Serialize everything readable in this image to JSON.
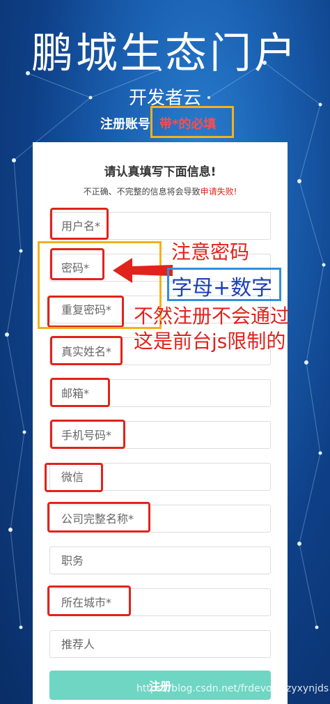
{
  "header": {
    "title": "鹏城生态门户",
    "subtitle": "开发者云",
    "register_label": "注册账号",
    "register_note": "带*的必填"
  },
  "card": {
    "heading": "请认真填写下面信息!",
    "sub_prefix": "不正确、不完整的信息将会导致",
    "sub_error": "申请失败!"
  },
  "fields": {
    "username": "用户名*",
    "password": "密码*",
    "password_repeat": "重复密码*",
    "real_name": "真实姓名*",
    "email": "邮箱*",
    "phone": "手机号码*",
    "wechat": "微信",
    "company": "公司完整名称*",
    "position": "职务",
    "city": "所在城市*",
    "referrer": "推荐人"
  },
  "submit_label": "注册",
  "annotations": {
    "note_password": "注意密码",
    "letters_digits": "字母+数字",
    "line_1": "不然注册不会通过",
    "line_2": "这是前台js限制的"
  },
  "watermark": "https://blog.csdn.net/frdevolcqzyxynjds",
  "colors": {
    "annotation_red": "#e0231b",
    "annotation_yellow": "#f2b21b",
    "annotation_blue": "#2f8fe0",
    "submit_button": "#6fd6c3"
  }
}
